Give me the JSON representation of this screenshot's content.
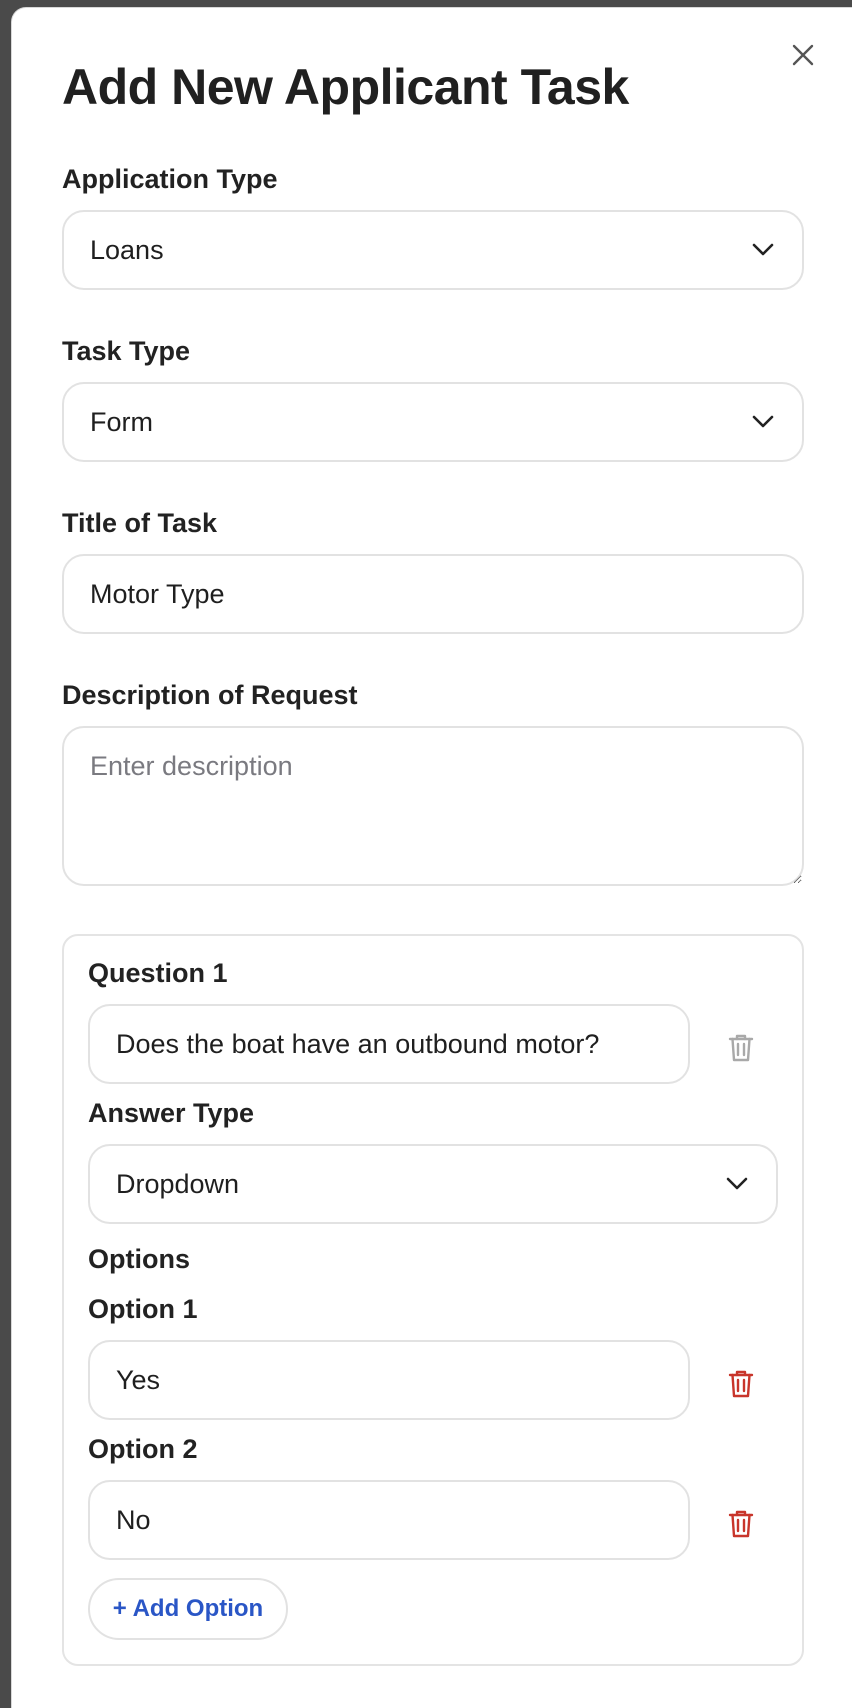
{
  "modal": {
    "title": "Add New Applicant Task"
  },
  "application_type": {
    "label": "Application Type",
    "value": "Loans"
  },
  "task_type": {
    "label": "Task Type",
    "value": "Form"
  },
  "task_title": {
    "label": "Title of Task",
    "value": "Motor Type"
  },
  "description": {
    "label": "Description of Request",
    "placeholder": "Enter description",
    "value": ""
  },
  "question": {
    "label": "Question 1",
    "value": "Does the boat have an outbound motor?",
    "answer_type_label": "Answer Type",
    "answer_type_value": "Dropdown",
    "options_label": "Options",
    "options": [
      {
        "label": "Option 1",
        "value": "Yes"
      },
      {
        "label": "Option 2",
        "value": "No"
      }
    ],
    "add_option_label": "+ Add Option"
  },
  "colors": {
    "accent": "#2a56c6",
    "danger": "#c8352b",
    "muted_icon": "#a9a9a9",
    "border": "#e2e2e2"
  },
  "icons": {
    "close": "close-icon",
    "chevron": "chevron-down-icon",
    "delete": "trash-icon"
  }
}
